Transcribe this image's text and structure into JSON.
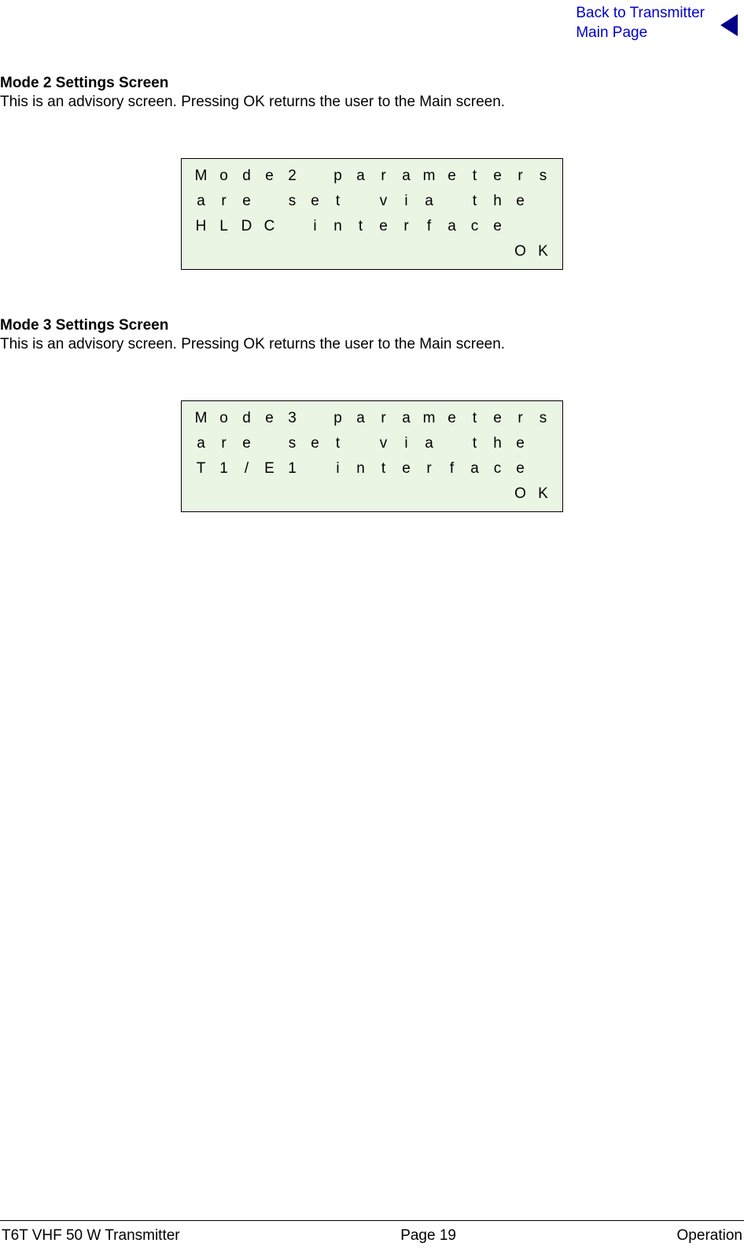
{
  "header": {
    "link_line1": "Back to Transmitter",
    "link_line2": "Main Page"
  },
  "sections": [
    {
      "heading": "Mode 2 Settings Screen",
      "text": "This is an advisory screen. Pressing OK returns the user to the Main screen.",
      "lcd": {
        "rows": [
          [
            "M",
            "o",
            "d",
            "e",
            "2",
            "",
            "p",
            "a",
            "r",
            "a",
            "m",
            "e",
            "t",
            "e",
            "r",
            "s"
          ],
          [
            "a",
            "r",
            "e",
            "",
            "s",
            "e",
            "t",
            "",
            "v",
            "i",
            "a",
            "",
            "t",
            "h",
            "e",
            ""
          ],
          [
            "H",
            "L",
            "D",
            "C",
            "",
            "i",
            "n",
            "t",
            "e",
            "r",
            "f",
            "a",
            "c",
            "e",
            "",
            ""
          ],
          [
            "",
            "",
            "",
            "",
            "",
            "",
            "",
            "",
            "",
            "",
            "",
            "",
            "",
            "",
            "O",
            "K"
          ]
        ]
      }
    },
    {
      "heading": "Mode 3 Settings Screen",
      "text": "This is an advisory screen. Pressing OK returns the user to the Main screen.",
      "lcd": {
        "rows": [
          [
            "M",
            "o",
            "d",
            "e",
            "3",
            "",
            "p",
            "a",
            "r",
            "a",
            "m",
            "e",
            "t",
            "e",
            "r",
            "s"
          ],
          [
            "a",
            "r",
            "e",
            "",
            "s",
            "e",
            "t",
            "",
            "v",
            "i",
            "a",
            "",
            "t",
            "h",
            "e",
            ""
          ],
          [
            "T",
            "1",
            "/",
            "E",
            "1",
            "",
            "i",
            "n",
            "t",
            "e",
            "r",
            "f",
            "a",
            "c",
            "e",
            ""
          ],
          [
            "",
            "",
            "",
            "",
            "",
            "",
            "",
            "",
            "",
            "",
            "",
            "",
            "",
            "",
            "O",
            "K"
          ]
        ]
      }
    }
  ],
  "footer": {
    "left": "T6T VHF 50 W Transmitter",
    "center": "Page 19",
    "right": "Operation"
  }
}
